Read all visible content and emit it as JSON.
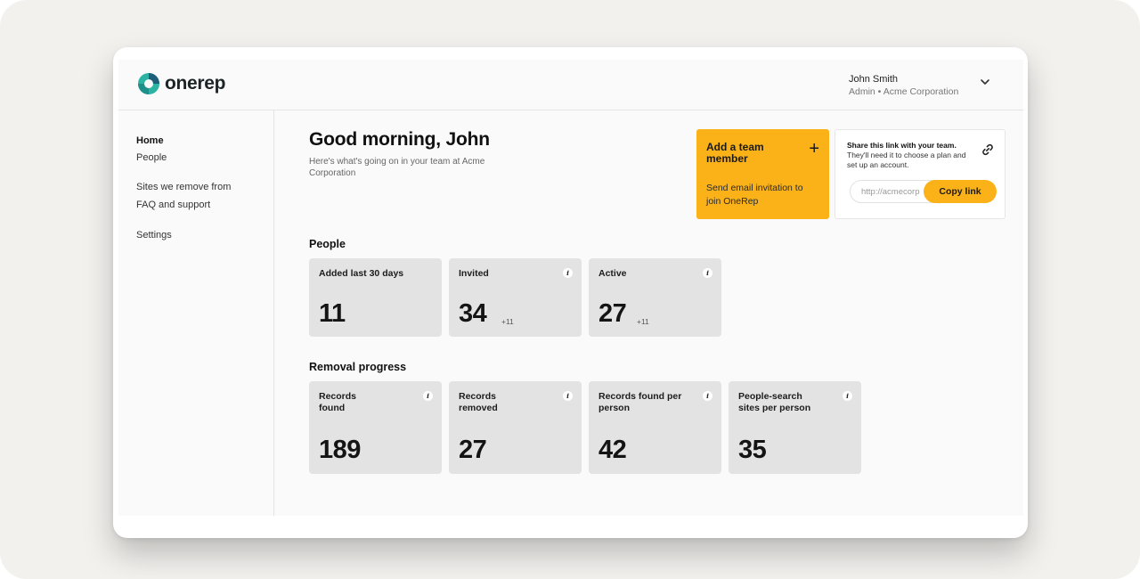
{
  "brand": {
    "name": "onerep",
    "logo_colors": [
      "#2bb3a3",
      "#1d5f7a"
    ]
  },
  "header": {
    "user_name": "John Smith",
    "user_role": "Admin • Acme Corporation",
    "menu_icon": "chevron-down-icon"
  },
  "sidebar": {
    "items": [
      {
        "label": "Home",
        "active": true
      },
      {
        "label": "People"
      },
      {
        "label": "Sites we remove from"
      },
      {
        "label": "FAQ and support"
      },
      {
        "label": "Settings"
      }
    ]
  },
  "main": {
    "greeting": "Good morning, John",
    "subtitle": "Here's what's going on in your team at Acme Corporation"
  },
  "add_member": {
    "title": "Add a team member",
    "plus_icon": "+",
    "description": "Send email invitation to join OneRep",
    "color": "#fbb218"
  },
  "share": {
    "text_bold": "Share this link with your team.",
    "text_rest": " They'll need it to choose a plan and set up an account.",
    "link_value": "http://acmecorp",
    "copy_label": "Copy link",
    "icon": "link-icon"
  },
  "people": {
    "title": "People",
    "cards": [
      {
        "label": "Added last 30 days",
        "value": "11",
        "delta": "",
        "info": false
      },
      {
        "label": "Invited",
        "value": "34",
        "delta": "+11",
        "info": true
      },
      {
        "label": "Active",
        "value": "27",
        "delta": "+11",
        "info": true
      }
    ]
  },
  "removal": {
    "title": "Removal progress",
    "cards": [
      {
        "label": "Records found",
        "value": "189",
        "info": true
      },
      {
        "label": "Records removed",
        "value": "27",
        "info": true
      },
      {
        "label": "Records found per person",
        "value": "42",
        "info": true
      },
      {
        "label": "People-search sites per person",
        "value": "35",
        "info": true
      }
    ]
  },
  "info_glyph": "i"
}
